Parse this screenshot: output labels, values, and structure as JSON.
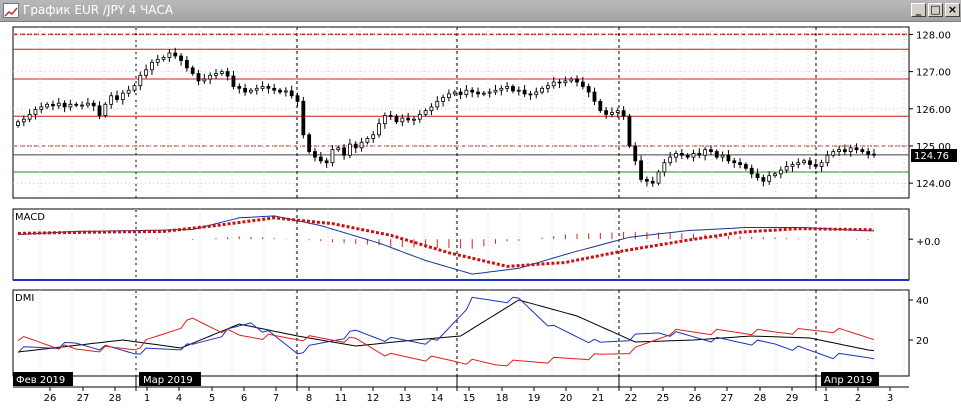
{
  "window": {
    "title": "График EUR /JPY  4 ЧАСА",
    "minimize_label": "_",
    "maximize_label": "□",
    "close_label": "×"
  },
  "chart_data": [
    {
      "type": "candlestick",
      "title": "",
      "ylim": [
        123.6,
        128.2
      ],
      "yticks": [
        "128.00",
        "127.00",
        "126.00",
        "125.00",
        "124.00"
      ],
      "current_price": "124.76",
      "horizontal_lines": {
        "red": [
          128.0,
          127.6,
          126.8,
          125.8,
          125.0
        ],
        "dark": [
          124.76
        ],
        "green": [
          124.3
        ]
      },
      "closes": [
        125.65,
        125.72,
        125.85,
        125.98,
        126.05,
        126.12,
        126.08,
        126.15,
        126.05,
        126.12,
        126.1,
        126.1,
        126.15,
        126.08,
        125.82,
        126.12,
        126.35,
        126.25,
        126.42,
        126.5,
        126.62,
        126.9,
        127.05,
        127.25,
        127.33,
        127.38,
        127.5,
        127.42,
        127.3,
        127.1,
        126.95,
        126.75,
        126.8,
        126.9,
        126.95,
        127.0,
        126.88,
        126.6,
        126.55,
        126.45,
        126.5,
        126.55,
        126.6,
        126.55,
        126.5,
        126.45,
        126.48,
        126.35,
        126.2,
        125.3,
        124.85,
        124.7,
        124.6,
        124.55,
        124.9,
        124.95,
        124.75,
        125.05,
        124.95,
        125.1,
        125.2,
        125.3,
        125.6,
        125.82,
        125.8,
        125.65,
        125.75,
        125.7,
        125.72,
        125.85,
        125.95,
        126.05,
        126.2,
        126.3,
        126.4,
        126.45,
        126.38,
        126.5,
        126.45,
        126.4,
        126.42,
        126.45,
        126.5,
        126.55,
        126.6,
        126.48,
        126.5,
        126.4,
        126.38,
        126.45,
        126.55,
        126.62,
        126.72,
        126.7,
        126.75,
        126.8,
        126.72,
        126.6,
        126.45,
        126.2,
        125.95,
        125.85,
        125.9,
        125.95,
        125.8,
        125.0,
        124.6,
        124.1,
        124.05,
        124.0,
        124.3,
        124.55,
        124.7,
        124.8,
        124.75,
        124.7,
        124.8,
        124.75,
        124.9,
        124.85,
        124.7,
        124.75,
        124.6,
        124.55,
        124.5,
        124.4,
        124.25,
        124.15,
        124.05,
        124.2,
        124.25,
        124.35,
        124.45,
        124.5,
        124.55,
        124.6,
        124.5,
        124.45,
        124.55,
        124.75,
        124.85,
        124.9,
        124.85,
        124.95,
        124.9,
        124.85,
        124.78,
        124.76
      ]
    },
    {
      "type": "line",
      "title": "MACD",
      "zero_label": "+0.0",
      "series": [
        {
          "kind": "line",
          "color": "#1a3399",
          "keys": [
            [
              0,
              0.12
            ],
            [
              10,
              0.2
            ],
            [
              20,
              0.22
            ],
            [
              30,
              0.25
            ],
            [
              38,
              0.55
            ],
            [
              44,
              0.6
            ],
            [
              52,
              0.35
            ],
            [
              62,
              -0.1
            ],
            [
              70,
              -0.55
            ],
            [
              78,
              -0.9
            ],
            [
              86,
              -0.75
            ],
            [
              95,
              -0.35
            ],
            [
              105,
              0.05
            ],
            [
              115,
              0.22
            ],
            [
              125,
              0.3
            ],
            [
              135,
              0.3
            ],
            [
              145,
              0.22
            ],
            [
              150,
              0.2
            ],
            [
              155,
              0.18
            ],
            [
              160,
              0.0
            ],
            [
              164,
              -0.4
            ],
            [
              169,
              -0.9
            ],
            [
              176,
              -0.78
            ],
            [
              190,
              -0.55
            ],
            [
              200,
              -0.5
            ],
            [
              207,
              -0.52
            ],
            [
              213,
              -0.4
            ],
            [
              222,
              -0.12
            ],
            [
              228,
              0.02
            ],
            [
              232,
              -0.02
            ]
          ]
        },
        {
          "kind": "signal",
          "color": "#cc1111",
          "keys": [
            [
              0,
              0.15
            ],
            [
              12,
              0.18
            ],
            [
              25,
              0.2
            ],
            [
              34,
              0.35
            ],
            [
              44,
              0.55
            ],
            [
              54,
              0.4
            ],
            [
              64,
              0.1
            ],
            [
              74,
              -0.35
            ],
            [
              84,
              -0.7
            ],
            [
              94,
              -0.6
            ],
            [
              104,
              -0.3
            ],
            [
              114,
              -0.05
            ],
            [
              124,
              0.18
            ],
            [
              134,
              0.27
            ],
            [
              144,
              0.25
            ],
            [
              156,
              0.22
            ],
            [
              164,
              0.05
            ],
            [
              172,
              -0.4
            ],
            [
              180,
              -0.65
            ],
            [
              194,
              -0.55
            ],
            [
              206,
              -0.48
            ],
            [
              216,
              -0.35
            ],
            [
              226,
              -0.1
            ],
            [
              232,
              0.0
            ]
          ]
        }
      ]
    },
    {
      "type": "line",
      "title": "DMI",
      "yticks": [
        "40",
        "20"
      ],
      "series": [
        {
          "kind": "adx",
          "color": "#000000",
          "keys": [
            [
              0,
              14
            ],
            [
              18,
              20
            ],
            [
              28,
              16
            ],
            [
              38,
              28
            ],
            [
              48,
              22
            ],
            [
              58,
              17
            ],
            [
              68,
              20
            ],
            [
              76,
              22
            ],
            [
              86,
              40
            ],
            [
              96,
              32
            ],
            [
              106,
              19
            ],
            [
              116,
              20
            ],
            [
              126,
              22
            ],
            [
              136,
              21
            ],
            [
              146,
              15
            ],
            [
              156,
              12
            ],
            [
              163,
              16
            ],
            [
              168,
              40
            ],
            [
              178,
              40
            ],
            [
              188,
              35
            ],
            [
              198,
              30
            ],
            [
              206,
              29
            ],
            [
              213,
              30
            ],
            [
              220,
              23
            ],
            [
              232,
              20
            ]
          ]
        },
        {
          "kind": "plus_di",
          "color": "#1f33bf",
          "keys": [
            [
              0,
              15
            ],
            [
              10,
              18
            ],
            [
              20,
              14
            ],
            [
              30,
              17
            ],
            [
              40,
              29
            ],
            [
              48,
              14
            ],
            [
              58,
              24
            ],
            [
              64,
              20
            ],
            [
              72,
              19
            ],
            [
              78,
              40
            ],
            [
              86,
              40
            ],
            [
              92,
              26
            ],
            [
              100,
              18
            ],
            [
              110,
              24
            ],
            [
              120,
              20
            ],
            [
              130,
              18
            ],
            [
              140,
              12
            ],
            [
              150,
              12
            ],
            [
              158,
              15
            ],
            [
              162,
              18
            ],
            [
              166,
              40
            ],
            [
              176,
              30
            ],
            [
              186,
              25
            ],
            [
              196,
              22
            ],
            [
              204,
              30
            ],
            [
              212,
              18
            ],
            [
              222,
              13
            ],
            [
              232,
              13
            ]
          ]
        },
        {
          "kind": "minus_di",
          "color": "#e01f1f",
          "keys": [
            [
              0,
              21
            ],
            [
              10,
              15
            ],
            [
              20,
              16
            ],
            [
              30,
              30
            ],
            [
              38,
              22
            ],
            [
              48,
              21
            ],
            [
              58,
              20
            ],
            [
              64,
              12
            ],
            [
              74,
              10
            ],
            [
              82,
              8
            ],
            [
              92,
              10
            ],
            [
              100,
              12
            ],
            [
              106,
              15
            ],
            [
              112,
              24
            ],
            [
              122,
              24
            ],
            [
              130,
              24
            ],
            [
              140,
              25
            ],
            [
              150,
              20
            ],
            [
              158,
              17
            ],
            [
              166,
              6
            ],
            [
              176,
              15
            ],
            [
              186,
              18
            ],
            [
              196,
              22
            ],
            [
              206,
              20
            ],
            [
              216,
              15
            ],
            [
              224,
              20
            ],
            [
              232,
              17
            ]
          ]
        }
      ]
    }
  ],
  "x_axis": {
    "ticks": [
      "26",
      "27",
      "28",
      "1",
      "4",
      "5",
      "6",
      "7",
      "8",
      "11",
      "12",
      "13",
      "14",
      "15",
      "18",
      "19",
      "20",
      "21",
      "22",
      "25",
      "26",
      "27",
      "28",
      "29",
      "1",
      "2",
      "3"
    ],
    "month_labels": [
      "Фев 2019",
      "Мар 2019",
      "Апр 2019"
    ]
  },
  "colors": {
    "title_bar": "#acacac",
    "macd_line": "#1a3399",
    "signal_line": "#cc1111",
    "price_tag": "#000000"
  }
}
